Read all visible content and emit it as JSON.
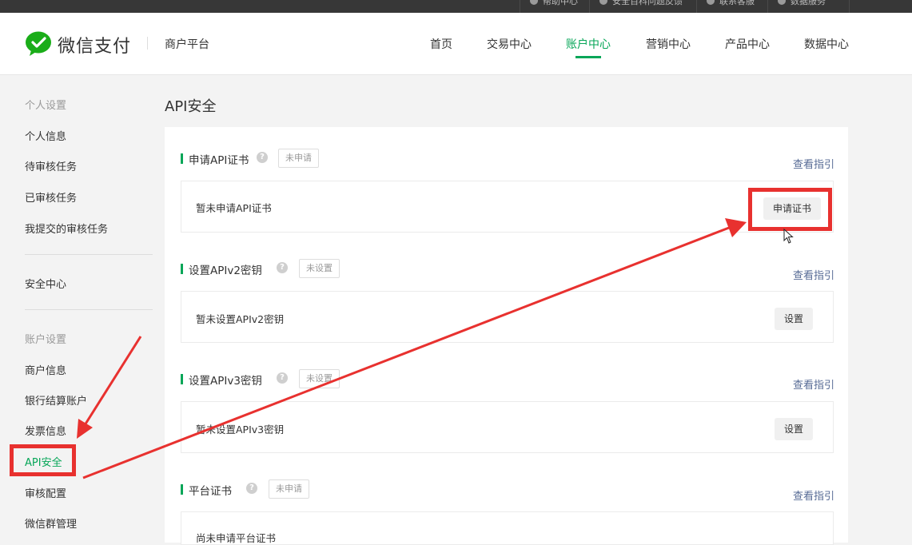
{
  "topbar": {
    "items": [
      "帮助中心",
      "安全百科问题反馈",
      "联系客服",
      "数据服务"
    ]
  },
  "header": {
    "brand": "微信支付",
    "platform": "商户平台",
    "nav": [
      "首页",
      "交易中心",
      "账户中心",
      "营销中心",
      "产品中心",
      "数据中心"
    ],
    "active_nav": "账户中心"
  },
  "sidebar": {
    "group1": "个人设置",
    "items1": [
      "个人信息",
      "待审核任务",
      "已审核任务",
      "我提交的审核任务"
    ],
    "security": "安全中心",
    "group2": "账户设置",
    "items2": [
      "商户信息",
      "银行结算账户",
      "发票信息",
      "API安全",
      "审核配置",
      "微信群管理"
    ],
    "active": "API安全"
  },
  "main": {
    "title": "API安全",
    "guide_label": "查看指引",
    "sections": [
      {
        "title": "申请API证书",
        "badge": "未申请",
        "text": "暂未申请API证书",
        "button": "申请证书"
      },
      {
        "title": "设置APIv2密钥",
        "badge": "未设置",
        "text": "暂未设置APIv2密钥",
        "button": "设置"
      },
      {
        "title": "设置APIv3密钥",
        "badge": "未设置",
        "text": "暂未设置APIv3密钥",
        "button": "设置"
      },
      {
        "title": "平台证书",
        "badge": "未申请",
        "text": "尚未申请平台证书"
      }
    ]
  },
  "colors": {
    "accent": "#07a658",
    "link": "#576b95",
    "annotation": "#e8312f",
    "topbar": "#373737"
  },
  "icons": [
    "wechat-pay-logo",
    "help-icon",
    "cursor-icon"
  ]
}
